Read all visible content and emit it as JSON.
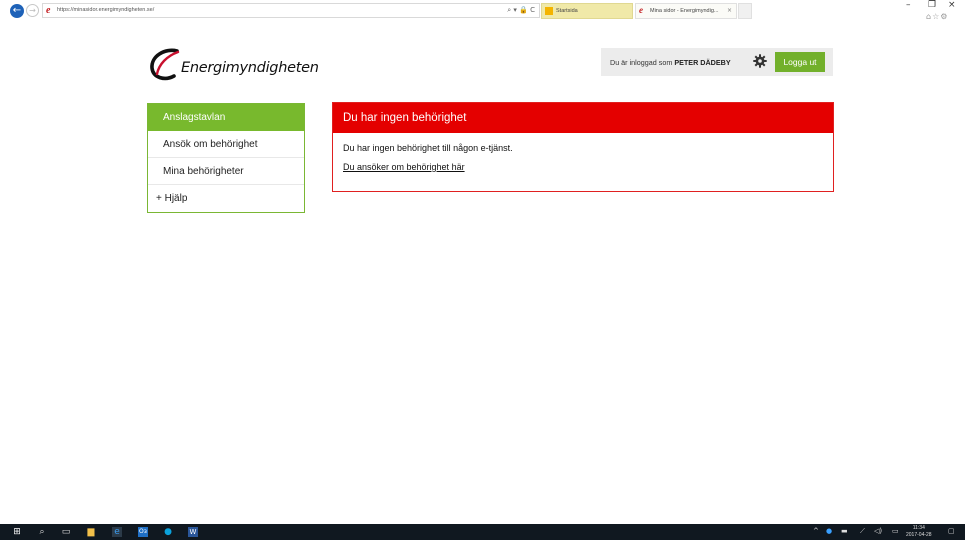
{
  "browser": {
    "url": "https://minasidor.energimyndigheten.se/",
    "tabs": [
      {
        "label": "Startsida"
      },
      {
        "label": "Mina sidor - Energimyndig..."
      }
    ],
    "tab_close": "×",
    "window_controls": {
      "minimize": "–",
      "maximize": "❐",
      "close": "×"
    },
    "address_tools": "⌕ ▾ 🔒 C"
  },
  "header": {
    "logo_text": "Energimyndigheten",
    "logged_in_prefix": "Du är inloggad som ",
    "user_name": "PETER DÄDEBY",
    "logout_label": "Logga ut"
  },
  "sidebar": {
    "items": [
      {
        "label": "Anslagstavlan"
      },
      {
        "label": "Ansök om behörighet"
      },
      {
        "label": "Mina behörigheter"
      },
      {
        "label": "+ Hjälp"
      }
    ]
  },
  "alert": {
    "title": "Du har ingen behörighet",
    "message": "Du har ingen behörighet till någon e-tjänst.",
    "link": "Du ansöker om behörighet här"
  },
  "taskbar": {
    "time": "11:34",
    "date": "2017-04-28"
  },
  "colors": {
    "brand_green": "#78b92d",
    "alert_red": "#e40000",
    "taskbar": "#101820"
  }
}
